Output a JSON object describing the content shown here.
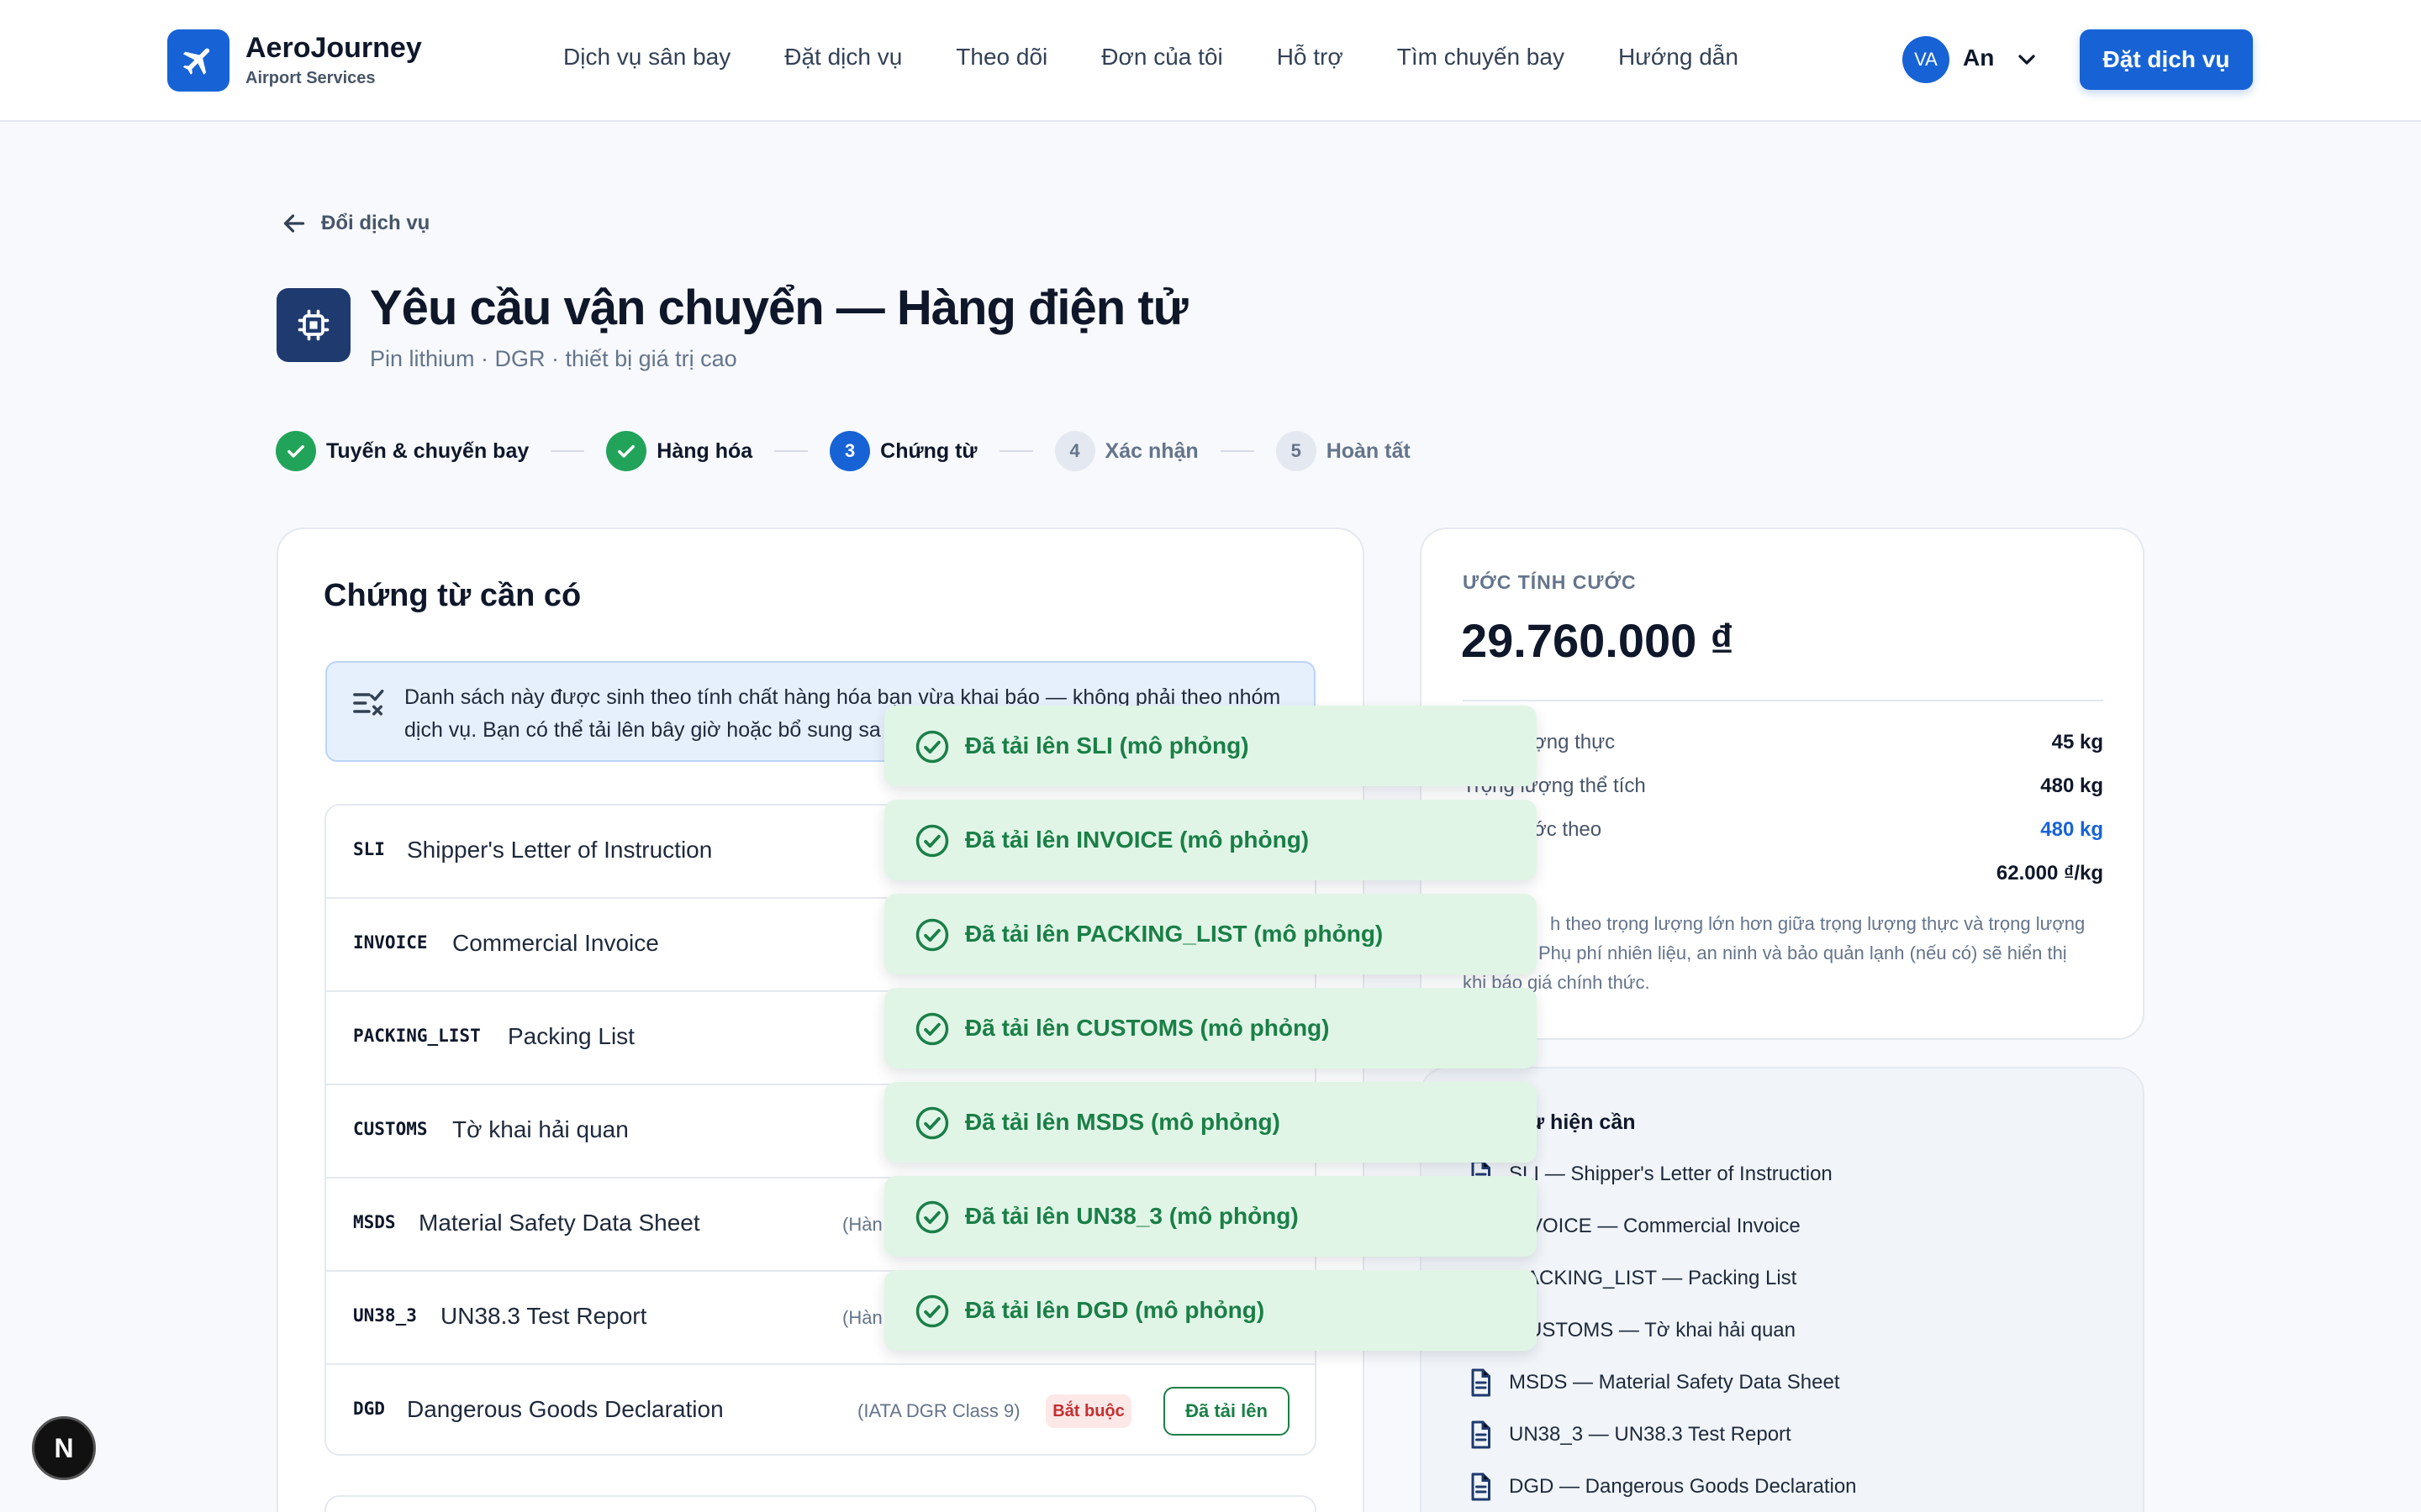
{
  "brand": {
    "name": "AeroJourney",
    "tagline": "Airport Services"
  },
  "nav": [
    "Dịch vụ sân bay",
    "Đặt dịch vụ",
    "Theo dõi",
    "Đơn của tôi",
    "Hỗ trợ",
    "Tìm chuyến bay",
    "Hướng dẫn"
  ],
  "user": {
    "initials": "VA",
    "name": "An"
  },
  "header_cta": "Đặt dịch vụ",
  "back_link": "Đổi dịch vụ",
  "page": {
    "title": "Yêu cầu vận chuyển — Hàng điện tử",
    "subtitle": "Pin lithium · DGR · thiết bị giá trị cao"
  },
  "steps": [
    {
      "label": "Tuyến & chuyến bay",
      "state": "done",
      "num": "1"
    },
    {
      "label": "Hàng hóa",
      "state": "done",
      "num": "2"
    },
    {
      "label": "Chứng từ",
      "state": "active",
      "num": "3"
    },
    {
      "label": "Xác nhận",
      "state": "pending",
      "num": "4"
    },
    {
      "label": "Hoàn tất",
      "state": "pending",
      "num": "5"
    }
  ],
  "documents": {
    "title": "Chứng từ cần có",
    "info_line1": "Danh sách này được sinh theo tính chất hàng hóa bạn vừa khai báo — không phải theo nhóm",
    "info_line2": "dịch vụ. Bạn có thể tải lên bây giờ hoặc bổ sung sa",
    "rows": [
      {
        "code": "SLI",
        "name": "Shipper's Letter of Instruction",
        "note": ""
      },
      {
        "code": "INVOICE",
        "name": "Commercial Invoice",
        "note": ""
      },
      {
        "code": "PACKING_LIST",
        "name": "Packing List",
        "note": ""
      },
      {
        "code": "CUSTOMS",
        "name": "Tờ khai hải quan",
        "note": ""
      },
      {
        "code": "MSDS",
        "name": "Material Safety Data Sheet",
        "note": "(Hàn"
      },
      {
        "code": "UN38_3",
        "name": "UN38.3 Test Report",
        "note": "(Hàn"
      },
      {
        "code": "DGD",
        "name": "Dangerous Goods Declaration",
        "note": "(IATA DGR Class 9)",
        "badge": "Bắt buộc",
        "action": "Đã tải lên"
      }
    ]
  },
  "estimate": {
    "label": "ƯỚC TÍNH CƯỚC",
    "total": "29.760.000 ₫",
    "rows": [
      {
        "label": "ợng thực",
        "value": "45 kg",
        "highlight": false
      },
      {
        "label": "Trọng lượng thể tích",
        "value": "480 kg",
        "highlight": false
      },
      {
        "label": "ớc theo",
        "value": "480 kg",
        "highlight": true
      },
      {
        "label": "",
        "value": "62.000 ₫/kg",
        "highlight": false
      }
    ],
    "note_line1": "h theo trọng lượng lớn hơn giữa trọng lượng thực và trọng lượng",
    "note_line2": "Phụ phí nhiên liệu, an ninh và bảo quản lạnh (nếu có) sẽ hiển thị",
    "note_line3": "khi báo giá chính thức."
  },
  "required": {
    "title": "ừ hiện cần",
    "items": [
      "SLI — Shipper's Letter of Instruction",
      "VOICE — Commercial Invoice",
      "ACKING_LIST — Packing List",
      "USTOMS — Tờ khai hải quan",
      "MSDS — Material Safety Data Sheet",
      "UN38_3 — UN38.3 Test Report",
      "DGD — Dangerous Goods Declaration"
    ]
  },
  "toasts": [
    "Đã tải lên SLI (mô phỏng)",
    "Đã tải lên INVOICE (mô phỏng)",
    "Đã tải lên PACKING_LIST (mô phỏng)",
    "Đã tải lên CUSTOMS (mô phỏng)",
    "Đã tải lên MSDS (mô phỏng)",
    "Đã tải lên UN38_3 (mô phỏng)",
    "Đã tải lên DGD (mô phỏng)"
  ],
  "dev_badge": "N",
  "colors": {
    "primary": "#1763d6",
    "success": "#22a35a",
    "navy": "#1e3a6e",
    "toast_bg": "#e1f5e7",
    "danger": "#c53030"
  }
}
